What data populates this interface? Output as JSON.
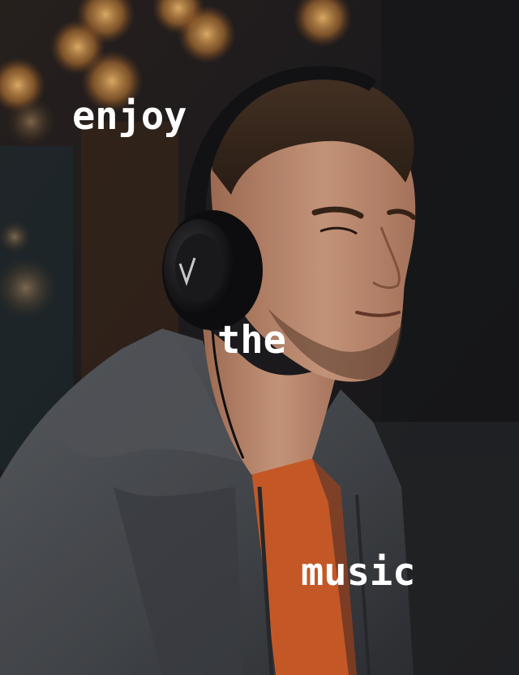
{
  "captions": {
    "word_1": "enjoy",
    "word_2": "the",
    "word_3": "music"
  },
  "photo": {
    "subject": "man-wearing-headphones",
    "colors": {
      "hoodie": "#4a4d52",
      "tshirt": "#d9602a",
      "headphones": "#1a1a1c",
      "skin": "#c99478",
      "hair": "#3b2a20",
      "bokeh": "#e8a455"
    }
  }
}
